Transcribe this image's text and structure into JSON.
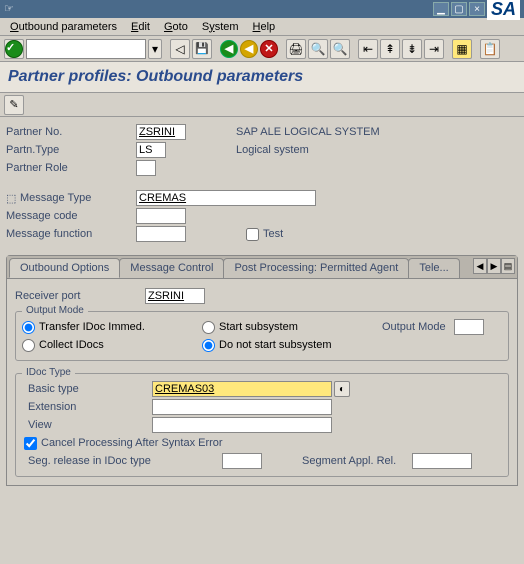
{
  "titlebar": {
    "text": ""
  },
  "menu": {
    "op": "Outbound parameters",
    "edit": "Edit",
    "goto": "Goto",
    "system": "System",
    "help": "Help"
  },
  "page": {
    "title": "Partner profiles: Outbound parameters"
  },
  "header": {
    "partnerNoLbl": "Partner No.",
    "partnerNo": "ZSRINI",
    "partnerNoDesc": "SAP ALE LOGICAL SYSTEM",
    "partnTypeLbl": "Partn.Type",
    "partnType": "LS",
    "partnTypeDesc": "Logical system",
    "partnerRoleLbl": "Partner Role",
    "partnerRole": "",
    "msgTypeLbl": "Message Type",
    "msgType": "CREMAS",
    "msgCodeLbl": "Message code",
    "msgCode": "",
    "msgFuncLbl": "Message function",
    "msgFunc": "",
    "testLbl": "Test"
  },
  "tabs": {
    "t1": "Outbound Options",
    "t2": "Message Control",
    "t3": "Post Processing: Permitted Agent",
    "t4": "Tele..."
  },
  "outbound": {
    "recvPortLbl": "Receiver port",
    "recvPort": "ZSRINI",
    "outputModeLegend": "Output Mode",
    "r1": "Transfer IDoc Immed.",
    "r2": "Collect IDocs",
    "r3": "Start subsystem",
    "r4": "Do not start subsystem",
    "outputModeLbl": "Output Mode",
    "outputMode": "",
    "idocTypeLegend": "IDoc Type",
    "basicTypeLbl": "Basic type",
    "basicType": "CREMAS03",
    "extensionLbl": "Extension",
    "extension": "",
    "viewLbl": "View",
    "view": "",
    "cancelSyntaxLbl": "Cancel Processing After Syntax Error",
    "segRelLbl": "Seg. release in IDoc type",
    "segRel": "",
    "segApplLbl": "Segment Appl. Rel.",
    "segAppl": ""
  }
}
